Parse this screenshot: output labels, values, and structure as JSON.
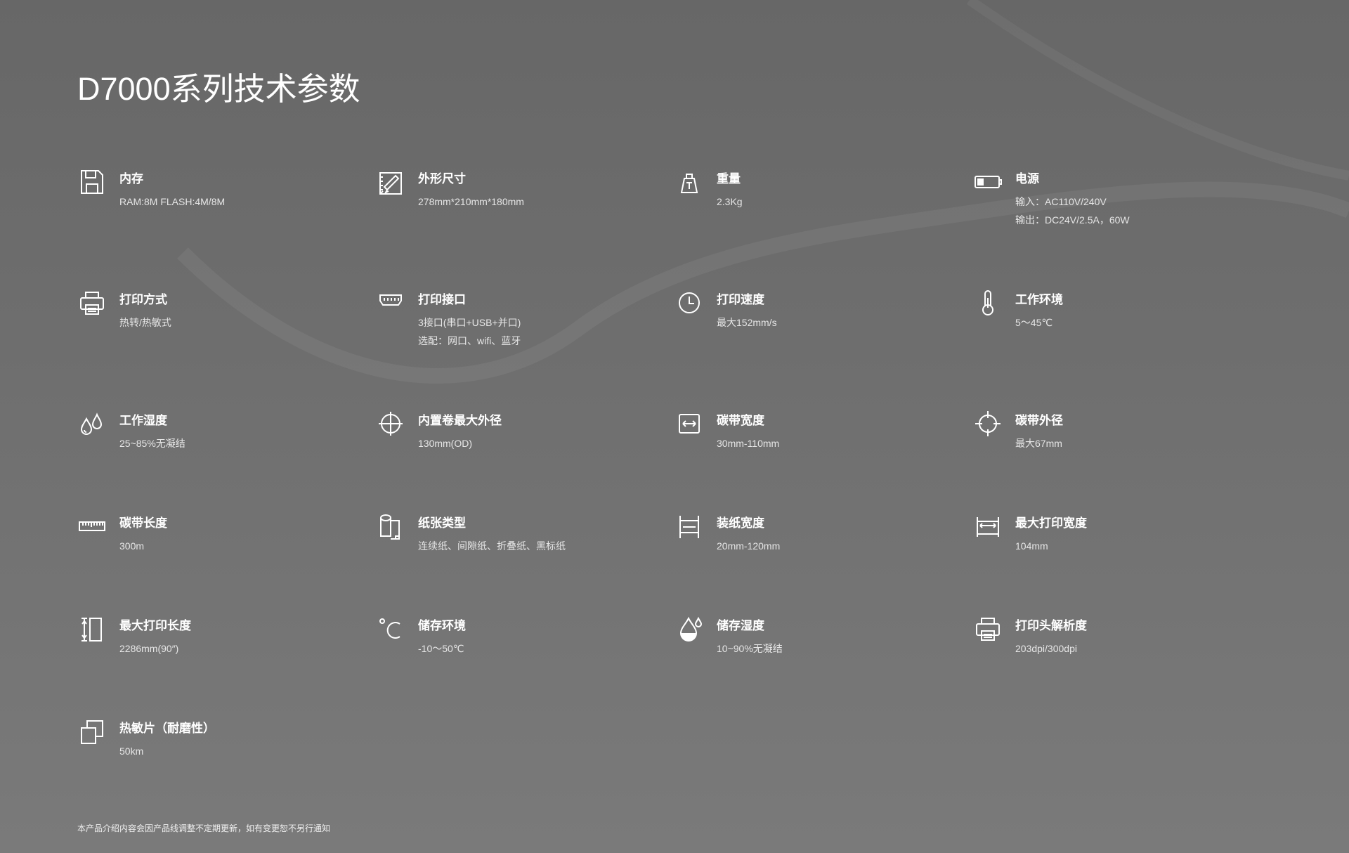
{
  "title": "D7000系列技术参数",
  "specs": [
    {
      "icon": "memory-card-icon",
      "label": "内存",
      "values": [
        "RAM:8M FLASH:4M/8M"
      ]
    },
    {
      "icon": "dimensions-icon",
      "label": "外形尺寸",
      "values": [
        "278mm*210mm*180mm"
      ]
    },
    {
      "icon": "weight-icon",
      "label": "重量",
      "values": [
        "2.3Kg"
      ]
    },
    {
      "icon": "battery-icon",
      "label": "电源",
      "values": [
        "输入：AC110V/240V",
        "输出：DC24V/2.5A，60W"
      ]
    },
    {
      "icon": "printer-icon",
      "label": "打印方式",
      "values": [
        "热转/热敏式"
      ]
    },
    {
      "icon": "port-icon",
      "label": "打印接口",
      "values": [
        "3接口(串口+USB+并口)",
        "选配：网口、wifi、蓝牙"
      ]
    },
    {
      "icon": "clock-icon",
      "label": "打印速度",
      "values": [
        "最大152mm/s"
      ]
    },
    {
      "icon": "thermometer-icon",
      "label": "工作环境",
      "values": [
        "5～45℃"
      ]
    },
    {
      "icon": "humidity-drops-icon",
      "label": "工作湿度",
      "values": [
        "25~85%无凝结"
      ]
    },
    {
      "icon": "crosshair-icon",
      "label": "内置卷最大外径",
      "values": [
        "130mm(OD)"
      ]
    },
    {
      "icon": "width-arrows-icon",
      "label": "碳带宽度",
      "values": [
        "30mm-110mm"
      ]
    },
    {
      "icon": "target-icon",
      "label": "碳带外径",
      "values": [
        "最大67mm"
      ]
    },
    {
      "icon": "ruler-icon",
      "label": "碳带长度",
      "values": [
        "300m"
      ]
    },
    {
      "icon": "paper-roll-icon",
      "label": "纸张类型",
      "values": [
        "连续纸、间隙纸、折叠纸、黑标纸"
      ]
    },
    {
      "icon": "paper-width-icon",
      "label": "装纸宽度",
      "values": [
        "20mm-120mm"
      ]
    },
    {
      "icon": "print-width-icon",
      "label": "最大打印宽度",
      "values": [
        "104mm"
      ]
    },
    {
      "icon": "print-length-icon",
      "label": "最大打印长度",
      "values": [
        "2286mm(90″)"
      ]
    },
    {
      "icon": "celsius-icon",
      "label": "储存环境",
      "values": [
        "-10～50℃"
      ]
    },
    {
      "icon": "water-drop-icon",
      "label": "储存湿度",
      "values": [
        "10~90%无凝结"
      ]
    },
    {
      "icon": "printhead-icon",
      "label": "打印头解析度",
      "values": [
        "203dpi/300dpi"
      ]
    },
    {
      "icon": "copy-icon",
      "label": "热敏片（耐磨性）",
      "values": [
        "50km"
      ]
    }
  ],
  "footer": "本产品介绍内容会因产品线调整不定期更新，如有变更恕不另行通知"
}
